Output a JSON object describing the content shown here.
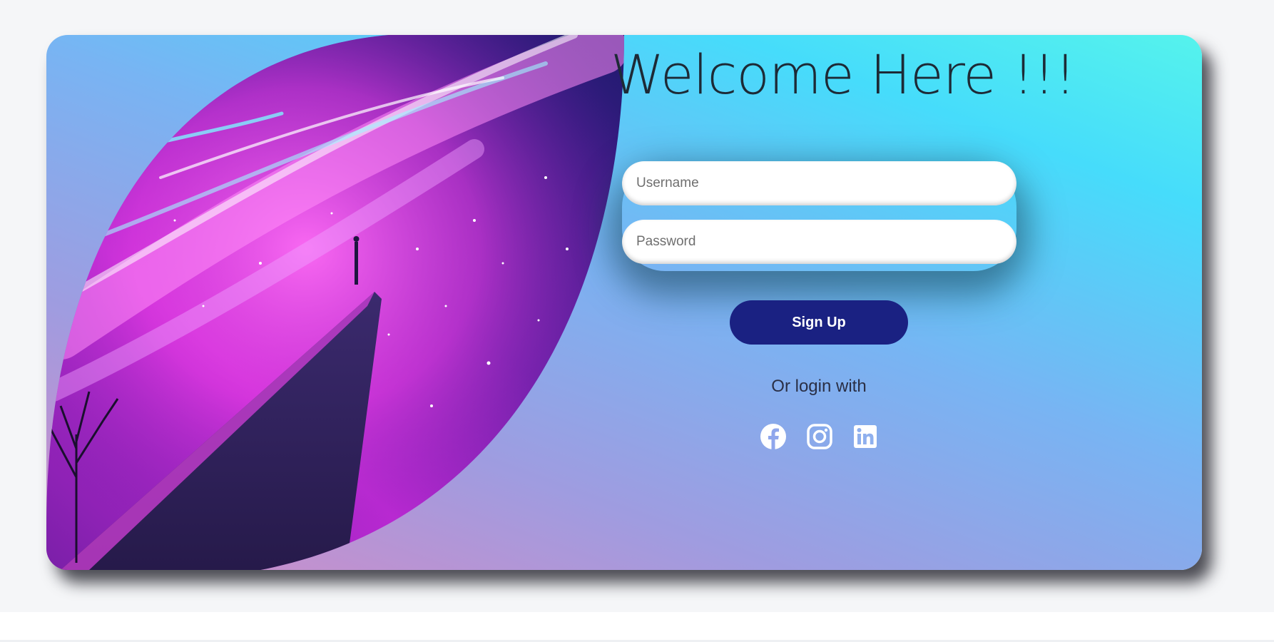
{
  "login": {
    "title": "Welcome Here !!!",
    "username_placeholder": "Username",
    "password_placeholder": "Password",
    "signup_label": "Sign Up",
    "alt_login_text": "Or login with"
  },
  "social": [
    {
      "name": "facebook-icon"
    },
    {
      "name": "instagram-icon"
    },
    {
      "name": "linkedin-icon"
    }
  ],
  "colors": {
    "page_background": "#f5f6f8",
    "signup_button": "#1a2182",
    "title_text": "#1d2a36",
    "card_gradient": [
      "#d48bc6",
      "#9f9ce0",
      "#78b4f3",
      "#46dcfb",
      "#55f3ec"
    ]
  }
}
